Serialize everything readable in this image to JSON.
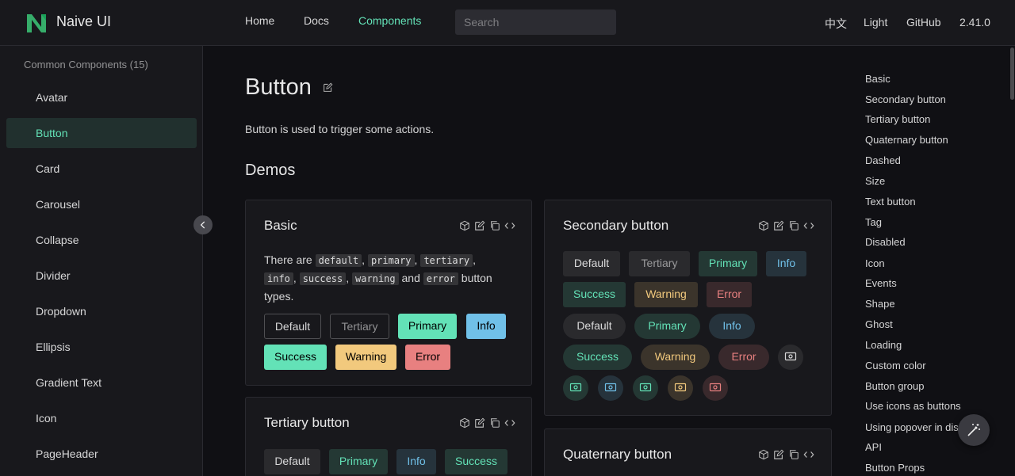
{
  "header": {
    "brand": "Naive UI",
    "nav": [
      "Home",
      "Docs",
      "Components"
    ],
    "search_placeholder": "Search",
    "right": [
      "中文",
      "Light",
      "GitHub",
      "2.41.0"
    ]
  },
  "sidebar": {
    "group_title": "Common Components (15)",
    "items": [
      "Avatar",
      "Button",
      "Card",
      "Carousel",
      "Collapse",
      "Divider",
      "Dropdown",
      "Ellipsis",
      "Gradient Text",
      "Icon",
      "PageHeader"
    ]
  },
  "main": {
    "title": "Button",
    "description": "Button is used to trigger some actions.",
    "demos_heading": "Demos",
    "basic": {
      "title": "Basic",
      "text_parts": [
        "There are ",
        "default",
        ", ",
        "primary",
        ", ",
        "tertiary",
        ", ",
        "info",
        ", ",
        "success",
        ", ",
        "warning",
        " and ",
        "error",
        " button types."
      ],
      "buttons": [
        "Default",
        "Tertiary",
        "Primary",
        "Info",
        "Success",
        "Warning",
        "Error"
      ]
    },
    "secondary": {
      "title": "Secondary button",
      "row1": [
        "Default",
        "Tertiary",
        "Primary",
        "Info"
      ],
      "row2": [
        "Success",
        "Warning",
        "Error"
      ],
      "row3": [
        "Default",
        "Primary",
        "Info"
      ],
      "row4": [
        "Success",
        "Warning",
        "Error"
      ]
    },
    "tertiary": {
      "title": "Tertiary button",
      "buttons": [
        "Default",
        "Primary",
        "Info",
        "Success"
      ]
    },
    "quaternary": {
      "title": "Quaternary button"
    }
  },
  "toc": [
    "Basic",
    "Secondary button",
    "Tertiary button",
    "Quaternary button",
    "Dashed",
    "Size",
    "Text button",
    "Tag",
    "Disabled",
    "Icon",
    "Events",
    "Shape",
    "Ghost",
    "Loading",
    "Custom color",
    "Button group",
    "Use icons as buttons",
    "Using popover in dis",
    "API",
    "Button Props"
  ],
  "colors": {
    "primary": "#63e2b7",
    "info": "#70c0e8",
    "warning": "#f2c97d",
    "error": "#e88080",
    "background": "#101014"
  }
}
